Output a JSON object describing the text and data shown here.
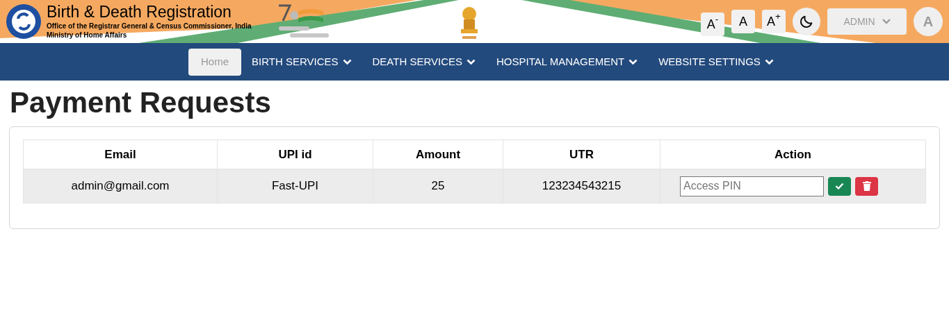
{
  "header": {
    "title": "Birth & Death Registration",
    "subtitle": "Office of the Registrar General & Census Commissioner, India",
    "ministry": "Ministry of Home Affairs",
    "font_buttons": [
      "A$^{-}$",
      "A",
      "A$^{+}$"
    ],
    "user_menu": {
      "label": "ADMIN"
    },
    "avatar": "A"
  },
  "nav": [
    {
      "label": "Home",
      "selected": true,
      "dropdown": false
    },
    {
      "label": "BIRTH SERVICES",
      "selected": false,
      "dropdown": true
    },
    {
      "label": "DEATH SERVICES",
      "selected": false,
      "dropdown": true
    },
    {
      "label": "HOSPITAL MANAGEMENT",
      "selected": false,
      "dropdown": true
    },
    {
      "label": "WEBSITE SETTINGS",
      "selected": false,
      "dropdown": true
    }
  ],
  "page_title": "Payment Requests",
  "table": {
    "columns": [
      "Email",
      "UPI id",
      "Amount",
      "UTR",
      "Action"
    ],
    "rows": [
      {
        "cells": [
          "admin@gmail.com",
          "Fast-UPI",
          "25",
          "123234543215"
        ],
        "pin_placeholder": "Access PIN"
      }
    ]
  }
}
